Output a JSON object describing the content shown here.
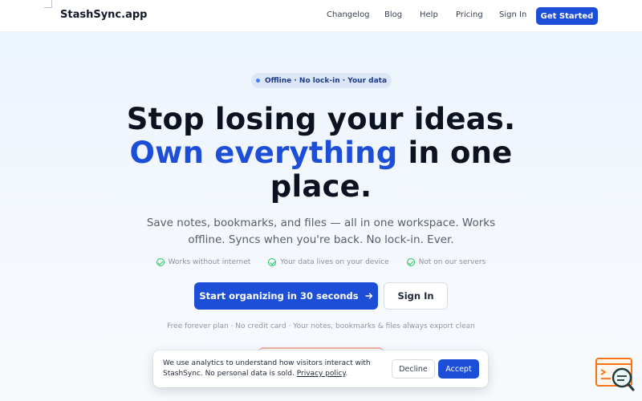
{
  "header": {
    "brand": "StashSync.app",
    "nav": [
      "Changelog",
      "Blog",
      "Help",
      "Pricing",
      "Sign In"
    ],
    "cta": "Get Started"
  },
  "hero": {
    "pill": "Offline · No lock-in · Your data",
    "headline_line1": "Stop losing your ideas.",
    "headline_accent": "Own everything",
    "headline_rest": " in one place.",
    "subtext": "Save notes, bookmarks, and files — all in one workspace. Works offline. Syncs when you're back. No lock-in. Ever.",
    "checks": [
      "Works without internet",
      "Your data lives on your device",
      "Not on our servers"
    ],
    "primary_cta": "Start organizing in 30 seconds",
    "secondary_cta": "Sign In",
    "fineprint": "Free forever plan · No credit card · Your notes, bookmarks & files always export clean"
  },
  "cookie": {
    "text": "We use analytics to understand how visitors interact with StashSync. No personal data is sold.",
    "link": "Privacy policy",
    "decline": "Decline",
    "accept": "Accept"
  },
  "colors": {
    "accent": "#1d4ed8",
    "check": "#22c55e",
    "widget": "#f97316"
  },
  "icons": {
    "arrow": "arrow-right-icon",
    "check": "check-circle-icon",
    "widget": "search-chat-icon"
  }
}
